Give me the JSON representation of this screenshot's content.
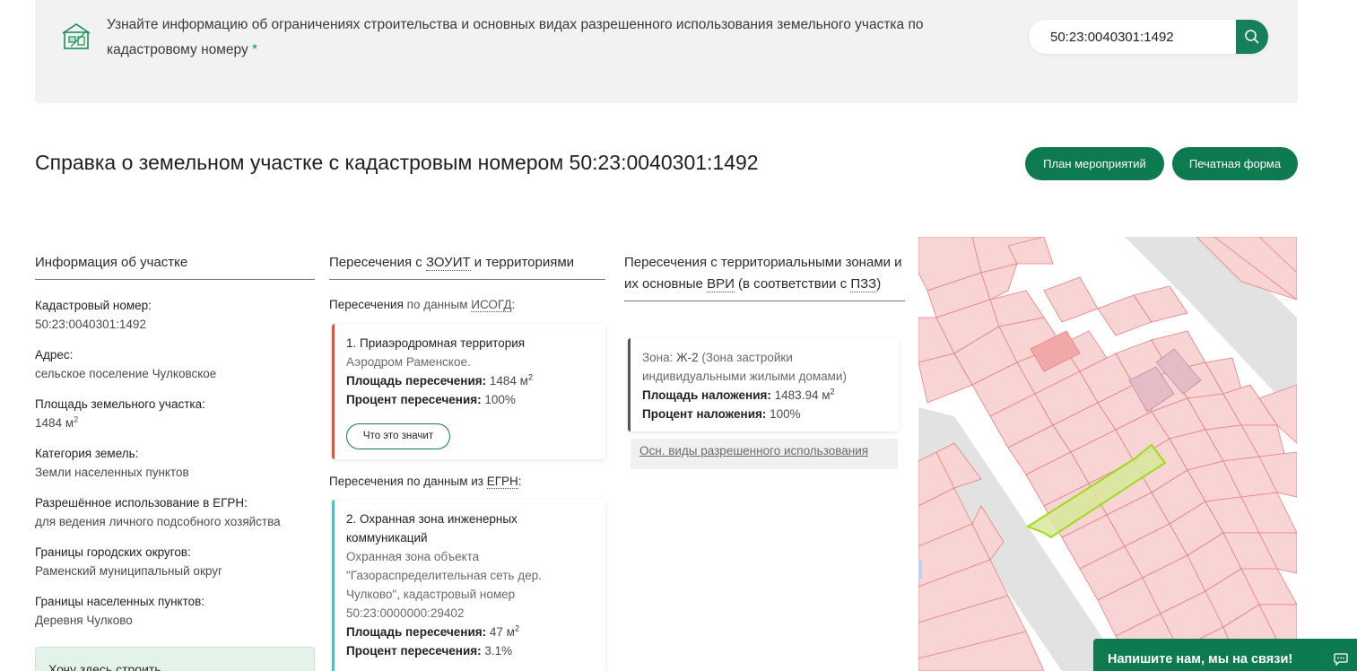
{
  "banner": {
    "text": "Узнайте информацию об ограничениях строительства и основных видах разрешенного использования земельного участка по кадастровому номеру",
    "asterisk": "*",
    "search_value": "50:23:0040301:1492",
    "icon": "house-plan-icon"
  },
  "page": {
    "title": "Справка о земельном участке с кадастровым номером 50:23:0040301:1492",
    "plan_button": "План мероприятий",
    "print_button": "Печатная форма"
  },
  "info": {
    "heading": "Информация об участке",
    "items": [
      {
        "label": "Кадастровый номер:",
        "value": "50:23:0040301:1492"
      },
      {
        "label": "Адрес:",
        "value": "сельское поселение Чулковское"
      },
      {
        "label": "Площадь земельного участка:",
        "value": "1484 м",
        "sup": "2"
      },
      {
        "label": "Категория земель:",
        "value": "Земли населенных пунктов"
      },
      {
        "label": "Разрешённое использование в ЕГРН:",
        "value": "для ведения личного подсобного хозяйства"
      },
      {
        "label": "Границы городских округов:",
        "value": "Раменский муниципальный округ"
      },
      {
        "label": "Границы населенных пунктов:",
        "value": "Деревня Чулково"
      }
    ],
    "want_text": "Хочу здесь строить"
  },
  "intersections": {
    "heading_pre": "Пересечения с ",
    "heading_abbr": "ЗОУИТ",
    "heading_post": " и территориями",
    "isogd_pre": "Пересечения ",
    "isogd_mid": "по данным ",
    "isogd_abbr": "ИСОГД",
    "isogd_post": ":",
    "card1": {
      "title": "1. Приаэродромная территория",
      "sub": "Аэродром Раменское.",
      "area_label": "Площадь пересечения:",
      "area_value": "1484 м",
      "area_sup": "2",
      "pct_label": "Процент пересечения:",
      "pct_value": "100%",
      "button": "Что это значит"
    },
    "egrn_pre": "Пересечения по данным из ",
    "egrn_abbr": "ЕГРН",
    "egrn_post": ":",
    "card2": {
      "title": "2. Охранная зона инженерных коммуникаций",
      "sub": "Охранная зона объекта \"Газораспределительная сеть дер. Чулково\", кадастровый номер 50:23:0000000:29402",
      "area_label": "Площадь пересечения:",
      "area_value": "47 м",
      "area_sup": "2",
      "pct_label": "Процент пересечения:",
      "pct_value": "3.1%"
    }
  },
  "zones": {
    "heading_pre": "Пересечения с территориальными зонами и их основные ",
    "heading_abbr1": "ВРИ",
    "heading_mid": " (в соответствии с ",
    "heading_abbr2": "ПЗЗ",
    "heading_post": ")",
    "card": {
      "zone_label": "Зона: ",
      "zone_value": "Ж-2",
      "zone_desc": " (Зона застройки индивидуальными жилыми домами)",
      "area_label": "Площадь наложения:",
      "area_value": "1483.94 м",
      "area_sup": "2",
      "pct_label": "Процент наложения:",
      "pct_value": "100%"
    },
    "vri_link": "Осн. виды разрешенного использования"
  },
  "map": {
    "parcel_color": "#d8e89a",
    "parcel_border": "#9edb1e",
    "lot_fill": "#f9d4d4",
    "lot_border": "#e77f7f",
    "road_color": "#e2e2e2"
  },
  "chat": {
    "label": "Напишите нам, мы на связи!",
    "icon": "chat-bubble-icon"
  },
  "colors": {
    "accent": "#0e7a50",
    "red_border": "#e0553a",
    "teal_border": "#4cc2c4"
  }
}
